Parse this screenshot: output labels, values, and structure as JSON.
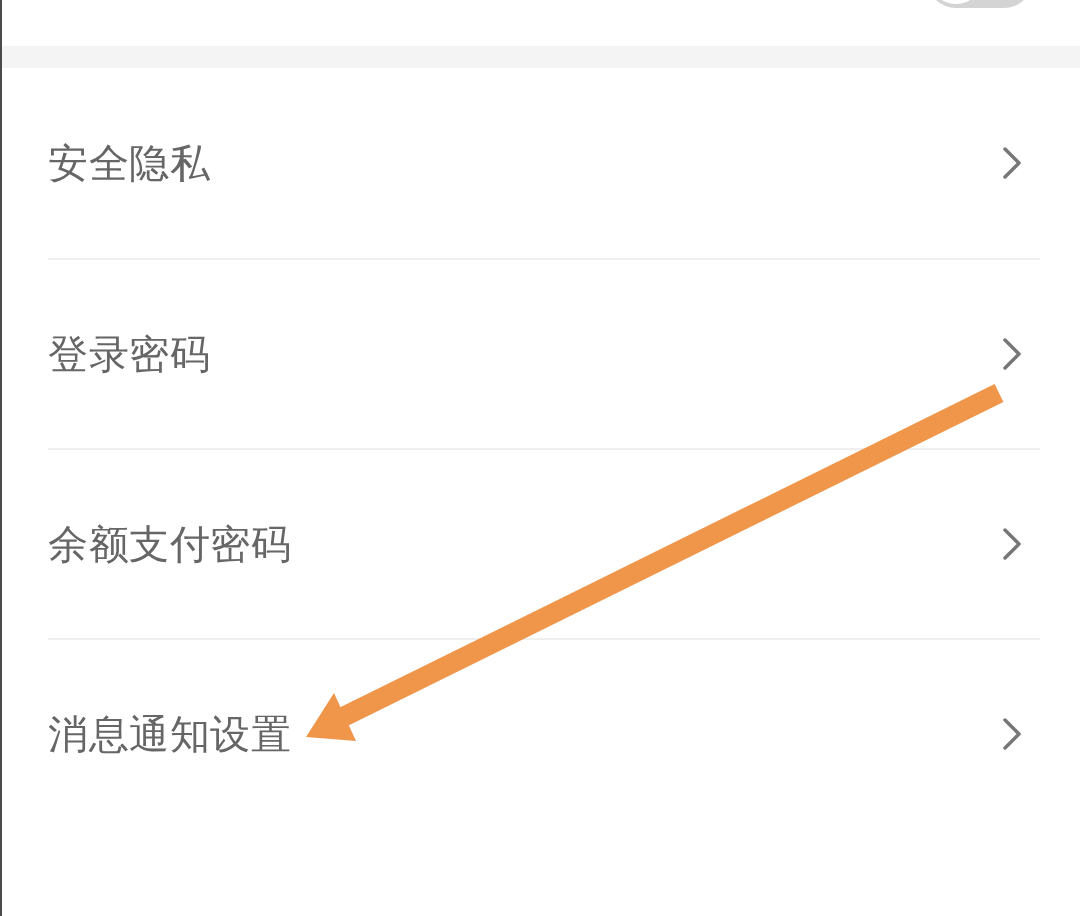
{
  "toggle": {
    "on": false
  },
  "items": [
    {
      "label": "安全隐私"
    },
    {
      "label": "登录密码"
    },
    {
      "label": "余额支付密码"
    },
    {
      "label": "消息通知设置"
    }
  ]
}
